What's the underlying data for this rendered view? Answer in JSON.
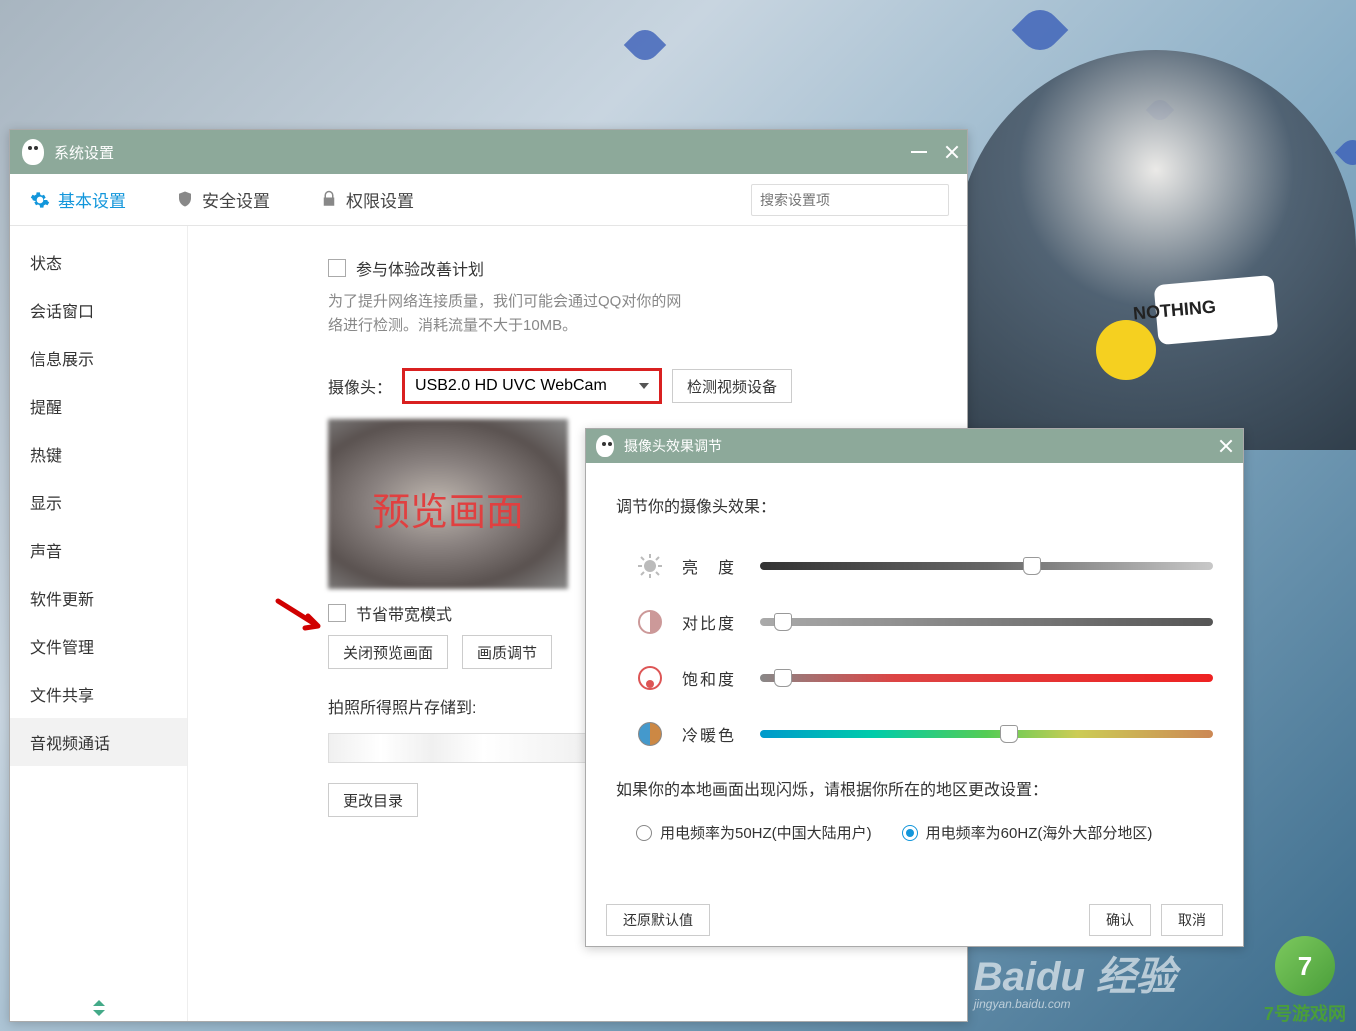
{
  "mainWindow": {
    "title": "系统设置",
    "tabs": {
      "basic": "基本设置",
      "security": "安全设置",
      "permission": "权限设置"
    },
    "search": {
      "placeholder": "搜索设置项"
    },
    "sidebar": {
      "items": [
        "状态",
        "会话窗口",
        "信息展示",
        "提醒",
        "热键",
        "显示",
        "声音",
        "软件更新",
        "文件管理",
        "文件共享",
        "音视频通话"
      ]
    },
    "content": {
      "checkbox1": "参与体验改善计划",
      "desc": "为了提升网络连接质量，我们可能会通过QQ对你的网络进行检测。消耗流量不大于10MB。",
      "cameraLabel": "摄像头：",
      "cameraValue": "USB2.0 HD UVC WebCam",
      "detectBtn": "检测视频设备",
      "previewText": "预览画面",
      "checkbox2": "节省带宽模式",
      "closePreviewBtn": "关闭预览画面",
      "qualityBtn": "画质调节",
      "photoPathLabel": "拍照所得照片存储到:",
      "changeDirBtn": "更改目录"
    }
  },
  "adjustWindow": {
    "title": "摄像头效果调节",
    "heading": "调节你的摄像头效果：",
    "sliders": {
      "brightness": {
        "label": "亮　度",
        "pos": 60
      },
      "contrast": {
        "label": "对比度",
        "pos": 5
      },
      "saturation": {
        "label": "饱和度",
        "pos": 5
      },
      "warmth": {
        "label": "冷暖色",
        "pos": 55
      }
    },
    "flickerText": "如果你的本地画面出现闪烁，请根据你所在的地区更改设置：",
    "radio50": "用电频率为50HZ(中国大陆用户)",
    "radio60": "用电频率为60HZ(海外大部分地区)",
    "resetBtn": "还原默认值",
    "okBtn": "确认",
    "cancelBtn": "取消"
  },
  "desktop": {
    "badgeText": "NOTHING"
  },
  "watermarks": {
    "baidu": "Baidu 经验",
    "baiduSub": "jingyan.baidu.com",
    "game7": "7号游戏网"
  }
}
